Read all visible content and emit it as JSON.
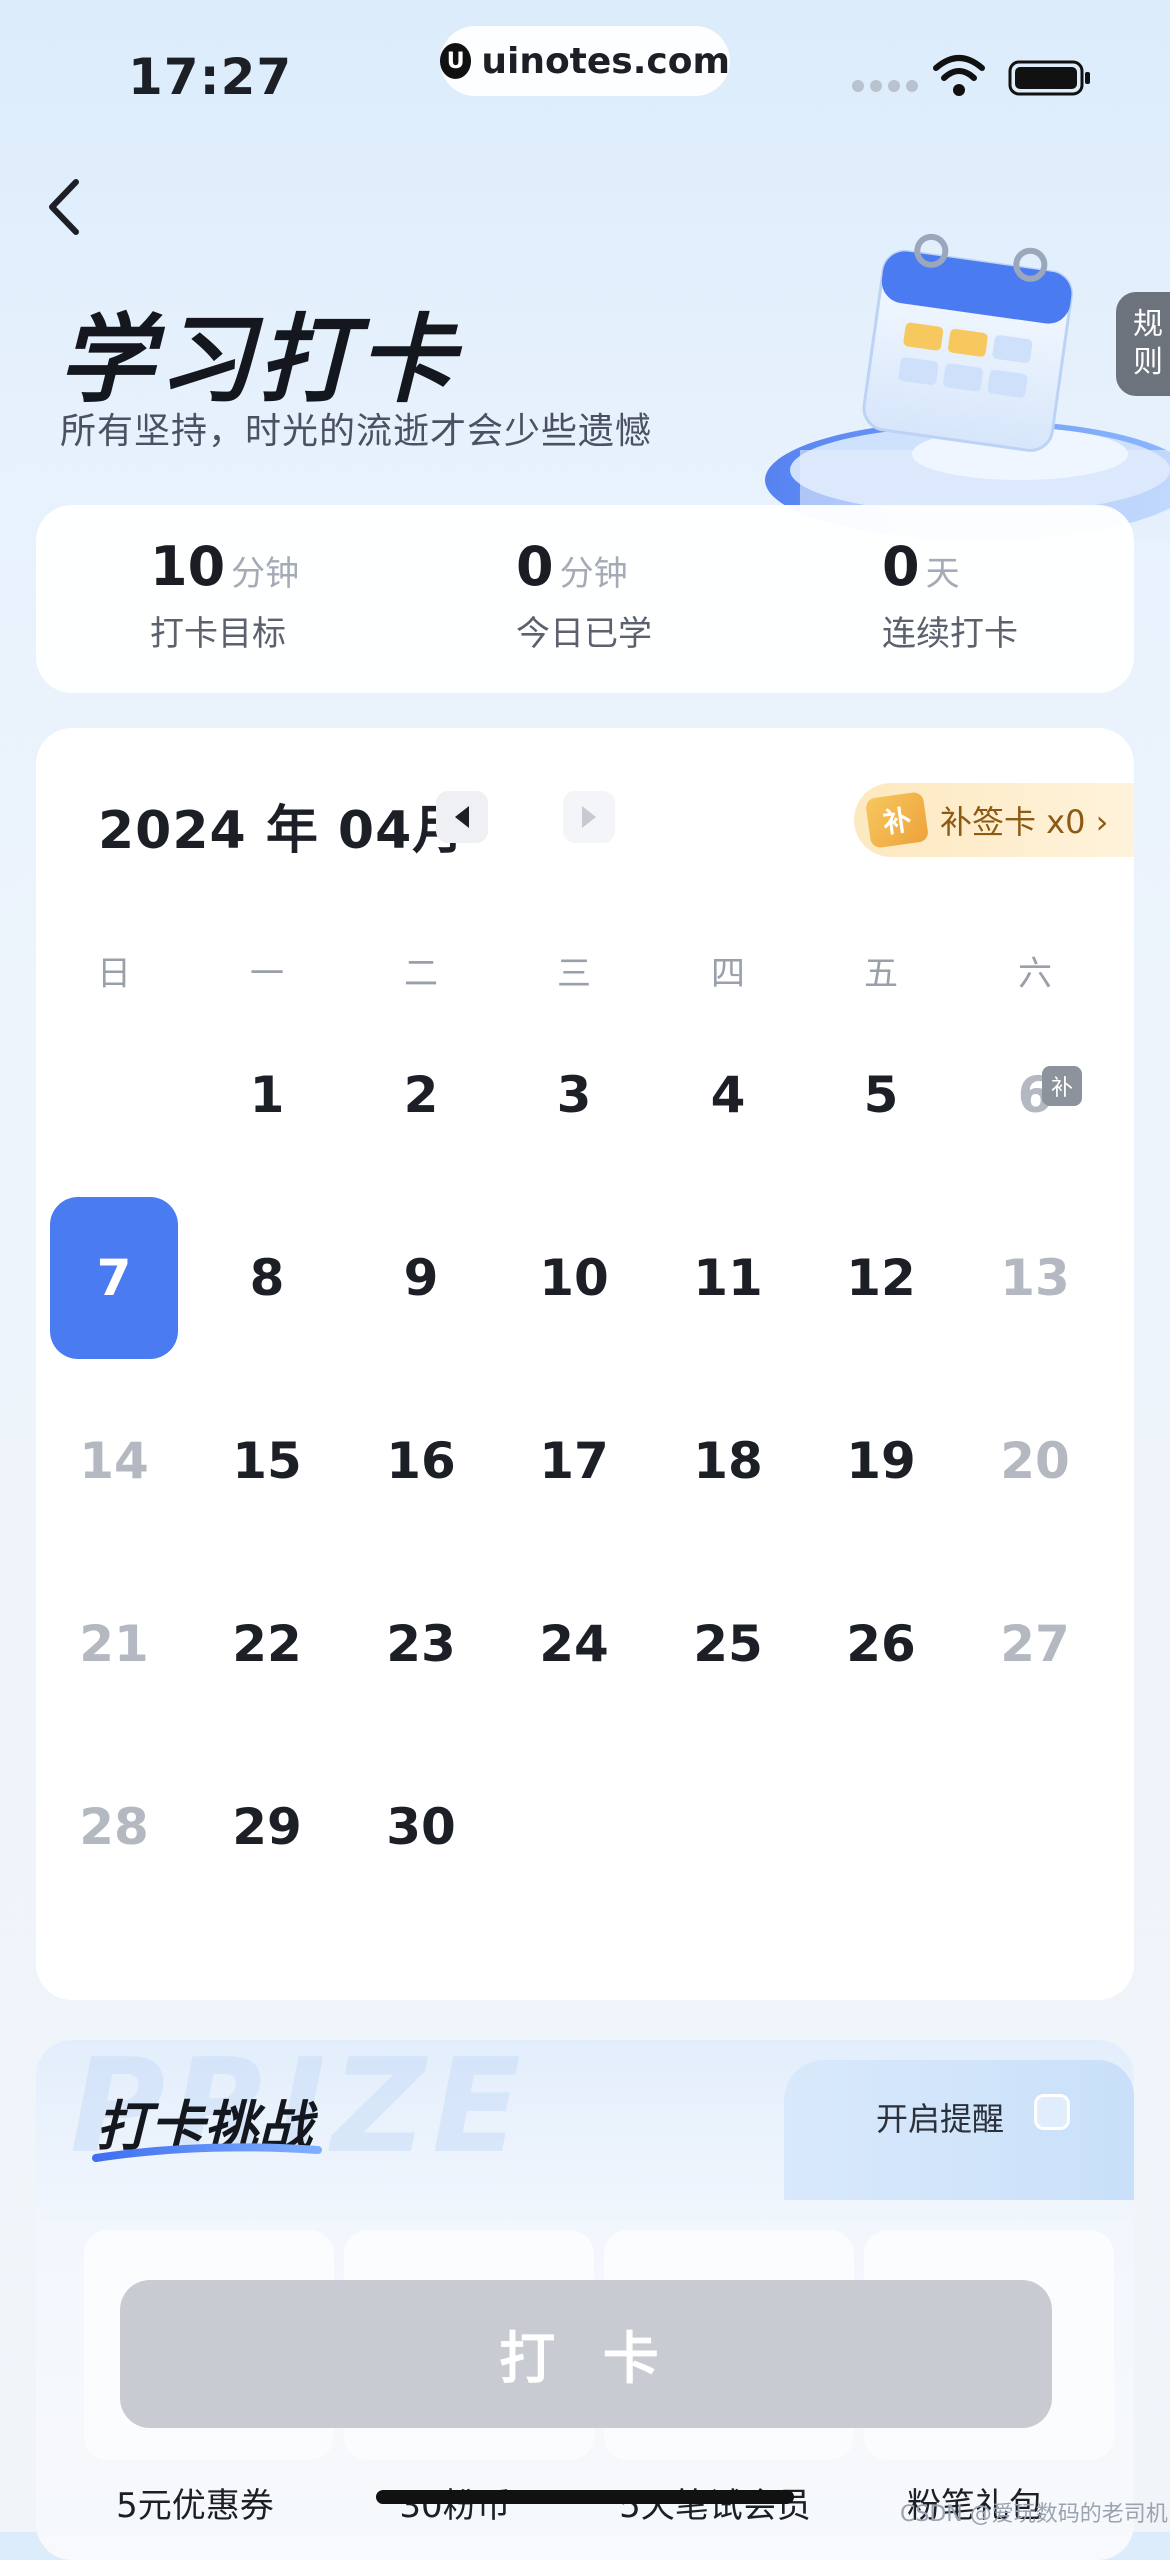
{
  "status_bar": {
    "time": "17:27",
    "url": "uinotes.com",
    "url_logo": "U"
  },
  "header": {
    "title": "学习打卡",
    "subtitle": "所有坚持，时光的流逝才会少些遗憾",
    "rules_tab": "规\n则"
  },
  "stats": [
    {
      "value": "10",
      "unit": "分钟",
      "label": "打卡目标"
    },
    {
      "value": "0",
      "unit": "分钟",
      "label": "今日已学"
    },
    {
      "value": "0",
      "unit": "天",
      "label": "连续打卡"
    }
  ],
  "calendar": {
    "month_title": "2024 年 04月",
    "makeup_badge": "补",
    "makeup_card_label": "补签卡 x0 ›",
    "makeup_tag": "补",
    "weekdays": [
      "日",
      "一",
      "二",
      "三",
      "四",
      "五",
      "六"
    ],
    "weeks": [
      [
        "",
        "1",
        "2",
        "3",
        "4",
        "5",
        "6"
      ],
      [
        "7",
        "8",
        "9",
        "10",
        "11",
        "12",
        "13"
      ],
      [
        "14",
        "15",
        "16",
        "17",
        "18",
        "19",
        "20"
      ],
      [
        "21",
        "22",
        "23",
        "24",
        "25",
        "26",
        "27"
      ],
      [
        "28",
        "29",
        "30",
        "",
        "",
        "",
        ""
      ]
    ],
    "today": "7"
  },
  "challenge": {
    "watermark": "PRIZE",
    "title": "打卡挑战",
    "reminder_label": "开启提醒",
    "prizes": [
      "5元优惠券",
      "30粉币",
      "5天笔试会员",
      "粉笔礼包"
    ],
    "checkin_button": "打 卡"
  },
  "footer": {
    "watermark": "CSDN @爱玩数码的老司机"
  },
  "colors": {
    "accent": "#4a7bf0",
    "muted_day": "#b3b8c1",
    "disabled_button": "#c8cbd2",
    "makeup_gold": "#f6c85e"
  }
}
